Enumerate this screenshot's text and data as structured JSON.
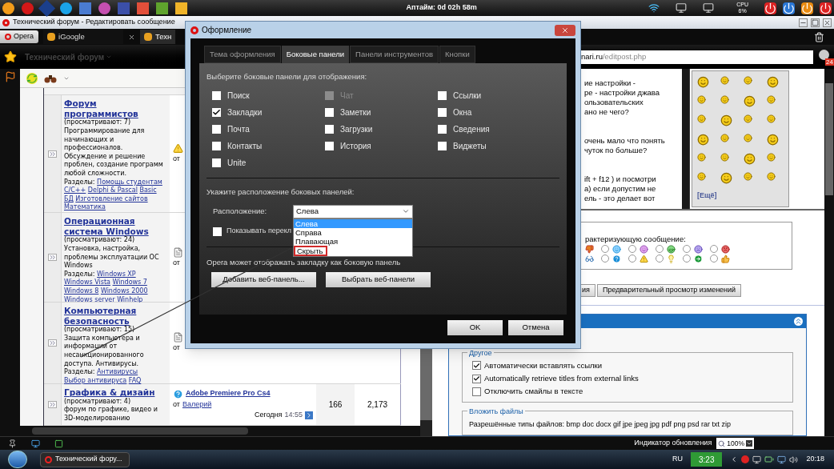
{
  "top_bar": {
    "uptime": "Аптайм: 0d 02h 58m",
    "cpu_label": "CPU",
    "cpu_value": "6%"
  },
  "browser": {
    "title": "Технический форум - Редактировать сообщение",
    "menu_button": "Opera",
    "tabs": [
      {
        "label": "iGoogle",
        "selected": false
      },
      {
        "label": "Техн",
        "selected": true
      }
    ],
    "site_menu": "Технический форум",
    "address": {
      "host": "nari.ru",
      "path": "/editpost.php"
    },
    "notification_count": "24"
  },
  "forum": {
    "rows": [
      {
        "title": "Форум программистов",
        "viewers": "(просматривают: 7)",
        "description": "Программирование для начинающих и профессионалов. Обсуждение и решение проблен, создание программ любой сложности.",
        "sections_label": "Разделы:",
        "sections": [
          "Помощь студентам",
          "C/C++",
          "Delphi & Pascal",
          "Basic",
          "БД",
          "Изготовление сайтов",
          "Математика"
        ],
        "last_post": {
          "kind": "warning",
          "by": "от"
        }
      },
      {
        "title": "Операционная система Windows",
        "viewers": "(просматривают: 24)",
        "description": "Установка, настройка, проблемы эксплуатации ОС Windows",
        "sections_label": "Разделы:",
        "sections": [
          "Windows XP",
          "Windows Vista",
          "Windows 7",
          "Windows 8",
          "Windows 2000",
          "Windows server",
          "Winhelp"
        ],
        "last_post": {
          "kind": "document",
          "by": "от"
        }
      },
      {
        "title": "Компьютерная безопасность",
        "viewers": "(просматривают: 15)",
        "description": "Защита компьютера и информации от несанкционированного доступа. Антивирусы.",
        "sections_label": "Разделы:",
        "sections": [
          "Антивирусы",
          "Выбор антивируса",
          "FAQ"
        ],
        "last_post": {
          "kind": "document",
          "by": "от"
        }
      },
      {
        "title": "Графика & дизайн",
        "viewers": "(просматривают: 4)",
        "description": "форум по графике, видео и 3D-моделированию",
        "last_post": {
          "kind": "question",
          "by": "от",
          "title": "Adobe Premiere Pro Cs4",
          "author": "Валерий",
          "date": "Сегодня",
          "time": "14:55"
        },
        "topics": "166",
        "posts": "2,173"
      }
    ]
  },
  "editor": {
    "paragraphs": [
      [
        "ие настройки  -",
        "ре - настройки джава",
        "ользовательских",
        "ано не чего?"
      ],
      [
        "очень мало что понять",
        "чуток по больше?"
      ],
      [
        "ift + f12 ) и посмотри",
        "а) если допустим не",
        "ель -  это делает вот"
      ]
    ],
    "more_smilies": "[Ещё]"
  },
  "rating": {
    "label": "рактеризующую сообщение:",
    "options": [
      {
        "selected": false
      },
      {
        "selected": false
      },
      {
        "selected": false
      },
      {
        "selected": false
      },
      {
        "selected": false
      },
      {
        "selected": false
      },
      {
        "selected": false
      },
      {
        "selected": false
      },
      {
        "selected": false
      },
      {
        "selected": false
      }
    ]
  },
  "form_buttons": [
    "ия",
    "Предварительный просмотр изменений"
  ],
  "other": {
    "legend": "Другое",
    "options": [
      {
        "label": "Автоматически вставлять ссылки",
        "checked": true
      },
      {
        "label": "Automatically retrieve titles from external links",
        "checked": true
      },
      {
        "label": "Отключить смайлы в тексте",
        "checked": false
      }
    ]
  },
  "attach": {
    "legend": "Вложить файлы",
    "allowed": "Разрешённые типы файлов: bmp doc docx gif jpe jpeg jpg pdf png psd rar txt zip"
  },
  "dialog": {
    "title": "Оформление",
    "tabs": [
      {
        "label": "Тема оформления",
        "selected": false
      },
      {
        "label": "Боковые панели",
        "selected": true
      },
      {
        "label": "Панели инструментов",
        "selected": false
      },
      {
        "label": "Кнопки",
        "selected": false
      }
    ],
    "panels_heading": "Выберите боковые панели для отображения:",
    "panel_columns": [
      [
        {
          "label": "Поиск",
          "checked": false,
          "disabled": false
        },
        {
          "label": "Закладки",
          "checked": true,
          "disabled": false
        },
        {
          "label": "Почта",
          "checked": false,
          "disabled": false
        },
        {
          "label": "Контакты",
          "checked": false,
          "disabled": false
        },
        {
          "label": "Unite",
          "checked": false,
          "disabled": false
        }
      ],
      [
        {
          "label": "Чат",
          "checked": false,
          "disabled": true
        },
        {
          "label": "Заметки",
          "checked": false,
          "disabled": false
        },
        {
          "label": "Загрузки",
          "checked": false,
          "disabled": false
        },
        {
          "label": "История",
          "checked": false,
          "disabled": false
        }
      ],
      [
        {
          "label": "Ссылки",
          "checked": false,
          "disabled": false
        },
        {
          "label": "Окна",
          "checked": false,
          "disabled": false
        },
        {
          "label": "Сведения",
          "checked": false,
          "disabled": false
        },
        {
          "label": "Виджеты",
          "checked": false,
          "disabled": false
        }
      ]
    ],
    "position_heading": "Укажите расположение боковых панелей:",
    "position_label": "Расположение:",
    "position": {
      "value": "Слева",
      "expanded": true,
      "options": [
        {
          "label": "Слева",
          "selected": true,
          "marked": false
        },
        {
          "label": "Справа",
          "selected": false,
          "marked": false
        },
        {
          "label": "Плавающая",
          "selected": false,
          "marked": false
        },
        {
          "label": "Скрыть",
          "selected": false,
          "marked": true
        }
      ]
    },
    "switcher": {
      "label": "Показывать перекл",
      "checked": false
    },
    "web_panel_text": "Opera может отображать закладку как боковую панель",
    "web_panel_buttons": [
      "Добавить веб-панель...",
      "Выбрать веб-панели"
    ],
    "buttons": [
      "OK",
      "Отмена"
    ]
  },
  "status_bar": {
    "update_label": "Индикатор обновления",
    "zoom": "100%"
  },
  "taskbar": {
    "task": "Технический фору...",
    "language": "RU",
    "timer": "3:23",
    "clock": "20:18"
  }
}
